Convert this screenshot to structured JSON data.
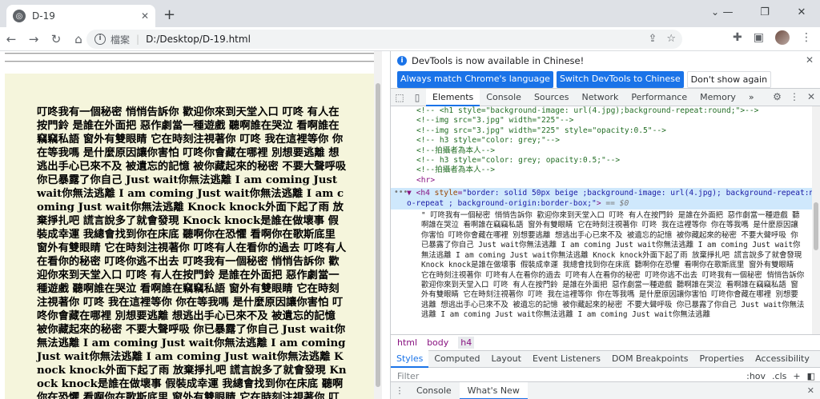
{
  "tab": {
    "title": "D-19",
    "favicon": "globe-icon"
  },
  "toolbar": {
    "scheme": "檔案",
    "url": "D:/Desktop/D-19.html"
  },
  "page": {
    "h4_text": "叮咚我有一個秘密 悄悄告訴你 歡迎你來到天堂入口 叮咚 有人在按門鈴 是誰在外面把 惡作劇當一種遊戲 聽啊誰在哭泣 看啊誰在竊竊私語 窗外有雙眼睛 它在時刻注視著你 叮咚 我在這裡等你 你在等我嗎 是什麼原因讓你害怕 叮咚你會藏在哪裡 別想要逃離 想逃出手心已來不及 被遺忘的記憶 被你藏起來的秘密 不要大聲呼吸 你已暴露了你自己 Just wait你無法逃離 I am coming Just wait你無法逃離 I am coming Just wait你無法逃離 I am coming Just wait你無法逃離 Knock knock外面下起了雨 放棄掙扎吧 謊言說多了就會發現 Knock knock是誰在做壞事 假裝成幸運 我總會找到你在床底 聽啊你在恐懼 看啊你在歌斯底里 窗外有雙眼睛 它在時刻注視著你 叮咚有人在看你的過去 叮咚有人在看你的秘密 叮咚你逃不出去 叮咚我有一個秘密 悄悄告訴你 歡迎你來到天堂入口 叮咚 有人在按門鈴 是誰在外面把 惡作劇當一種遊戲 聽啊誰在哭泣 看啊誰在竊竊私語 窗外有雙眼睛 它在時刻注視著你 叮咚 我在這裡等你 你在等我嗎 是什麼原因讓你害怕 叮咚你會藏在哪裡 別想要逃離 想逃出手心已來不及 被遺忘的記憶 被你藏起來的秘密 不要大聲呼吸 你已暴露了你自己 Just wait你無法逃離 I am coming Just wait你無法逃離 I am coming Just wait你無法逃離 I am coming Just wait你無法逃離 Knock knock外面下起了雨 放棄掙扎吧 謊言說多了就會發現 Knock knock是誰在做壞事 假裝成幸運 我總會找到你在床底 聽啊你在恐懼 看啊你在歌斯底里 窗外有雙眼睛 它在時刻注視著你 叮咚有人在看你的過去 叮咚有人在看你的秘密 叮咚你逃不出去"
  },
  "devtools": {
    "infobar": {
      "message": "DevTools is now available in Chinese!",
      "btn_match": "Always match Chrome's language",
      "btn_switch": "Switch DevTools to Chinese",
      "btn_dismiss": "Don't show again"
    },
    "tabs": [
      "Elements",
      "Console",
      "Sources",
      "Network",
      "Performance",
      "Memory"
    ],
    "more_tabs": "»",
    "code_lines": [
      "<!--  <h1 style=\"background-image: url(4.jpg);background-repeat:round;\">-->",
      "<!--img src=\"3.jpg\" width=\"225\"-->",
      "<!--img src=\"3.jpg\" width=\"225\" style=\"opacity:0.5\"-->",
      "<!-- h3 style=\"color: grey;\"-->",
      "<!--拍攝者為本人-->",
      "<!-- h3 style=\"color: grey; opacity:0.5;\"-->",
      "<!--拍攝者為本人-->"
    ],
    "hr_tag": "<hr>",
    "selected": {
      "tag_open": "<h4",
      "attr_name": "style",
      "attr_value": "\"border: solid 50px beige ;background-image: url(4.jpg); background-repeat:no-repeat ; background-origin:border-box;\"",
      "tag_close": ">",
      "dollar": "== $0"
    },
    "text_node": "\" 叮咚我有一個秘密 悄悄告訴你 歡迎你來到天堂入口 叮咚 有人在按門鈴 是誰在外面把 惡作劇當一種遊戲 聽啊誰在哭泣 看啊誰在竊竊私語 窗外有雙眼睛 它在時刻注視著你 叮咚 我在這裡等你 你在等我嗎 是什麼原因讓你害怕 叮咚你會藏在哪裡 別想要逃離 想逃出手心已來不及 被遺忘的記憶 被你藏起來的秘密 不要大聲呼吸 你已暴露了你自己 Just wait你無法逃離 I am coming Just wait你無法逃離 I am coming Just wait你無法逃離 I am coming Just wait你無法逃離 Knock knock外面下起了雨 放棄掙扎吧 謊言說多了就會發現 Knock knock是誰在做壞事 假裝成幸運 我總會找到你在床底 聽啊你在恐懼 看啊你在歌斯底里 窗外有雙眼睛 它在時刻注視著你 叮咚有人在看你的過去 叮咚有人在看你的秘密 叮咚你逃不出去 叮咚我有一個秘密 悄悄告訴你 歡迎你來到天堂入口 叮咚 有人在按門鈴 是誰在外面把 惡作劇當一種遊戲 聽啊誰在哭泣 看啊誰在竊竊私語 窗外有雙眼睛 它在時刻注視著你 叮咚 我在這裡等你 你在等我嗎 是什麼原因讓你害怕 叮咚你會藏在哪裡 別想要逃離 想逃出手心已來不及 被遺忘的記憶 被你藏起來的秘密 不要大聲呼吸 你已暴露了你自己 Just wait你無法逃離 I am coming Just wait你無法逃離 I am coming Just wait你無法逃離",
    "breadcrumbs": [
      "html",
      "body",
      "h4"
    ],
    "subtabs": [
      "Styles",
      "Computed",
      "Layout",
      "Event Listeners",
      "DOM Breakpoints",
      "Properties",
      "Accessibility"
    ],
    "filter_placeholder": "Filter",
    "filter_hov": ":hov",
    "filter_cls": ".cls",
    "drawer_tabs": [
      "Console",
      "What's New"
    ]
  }
}
